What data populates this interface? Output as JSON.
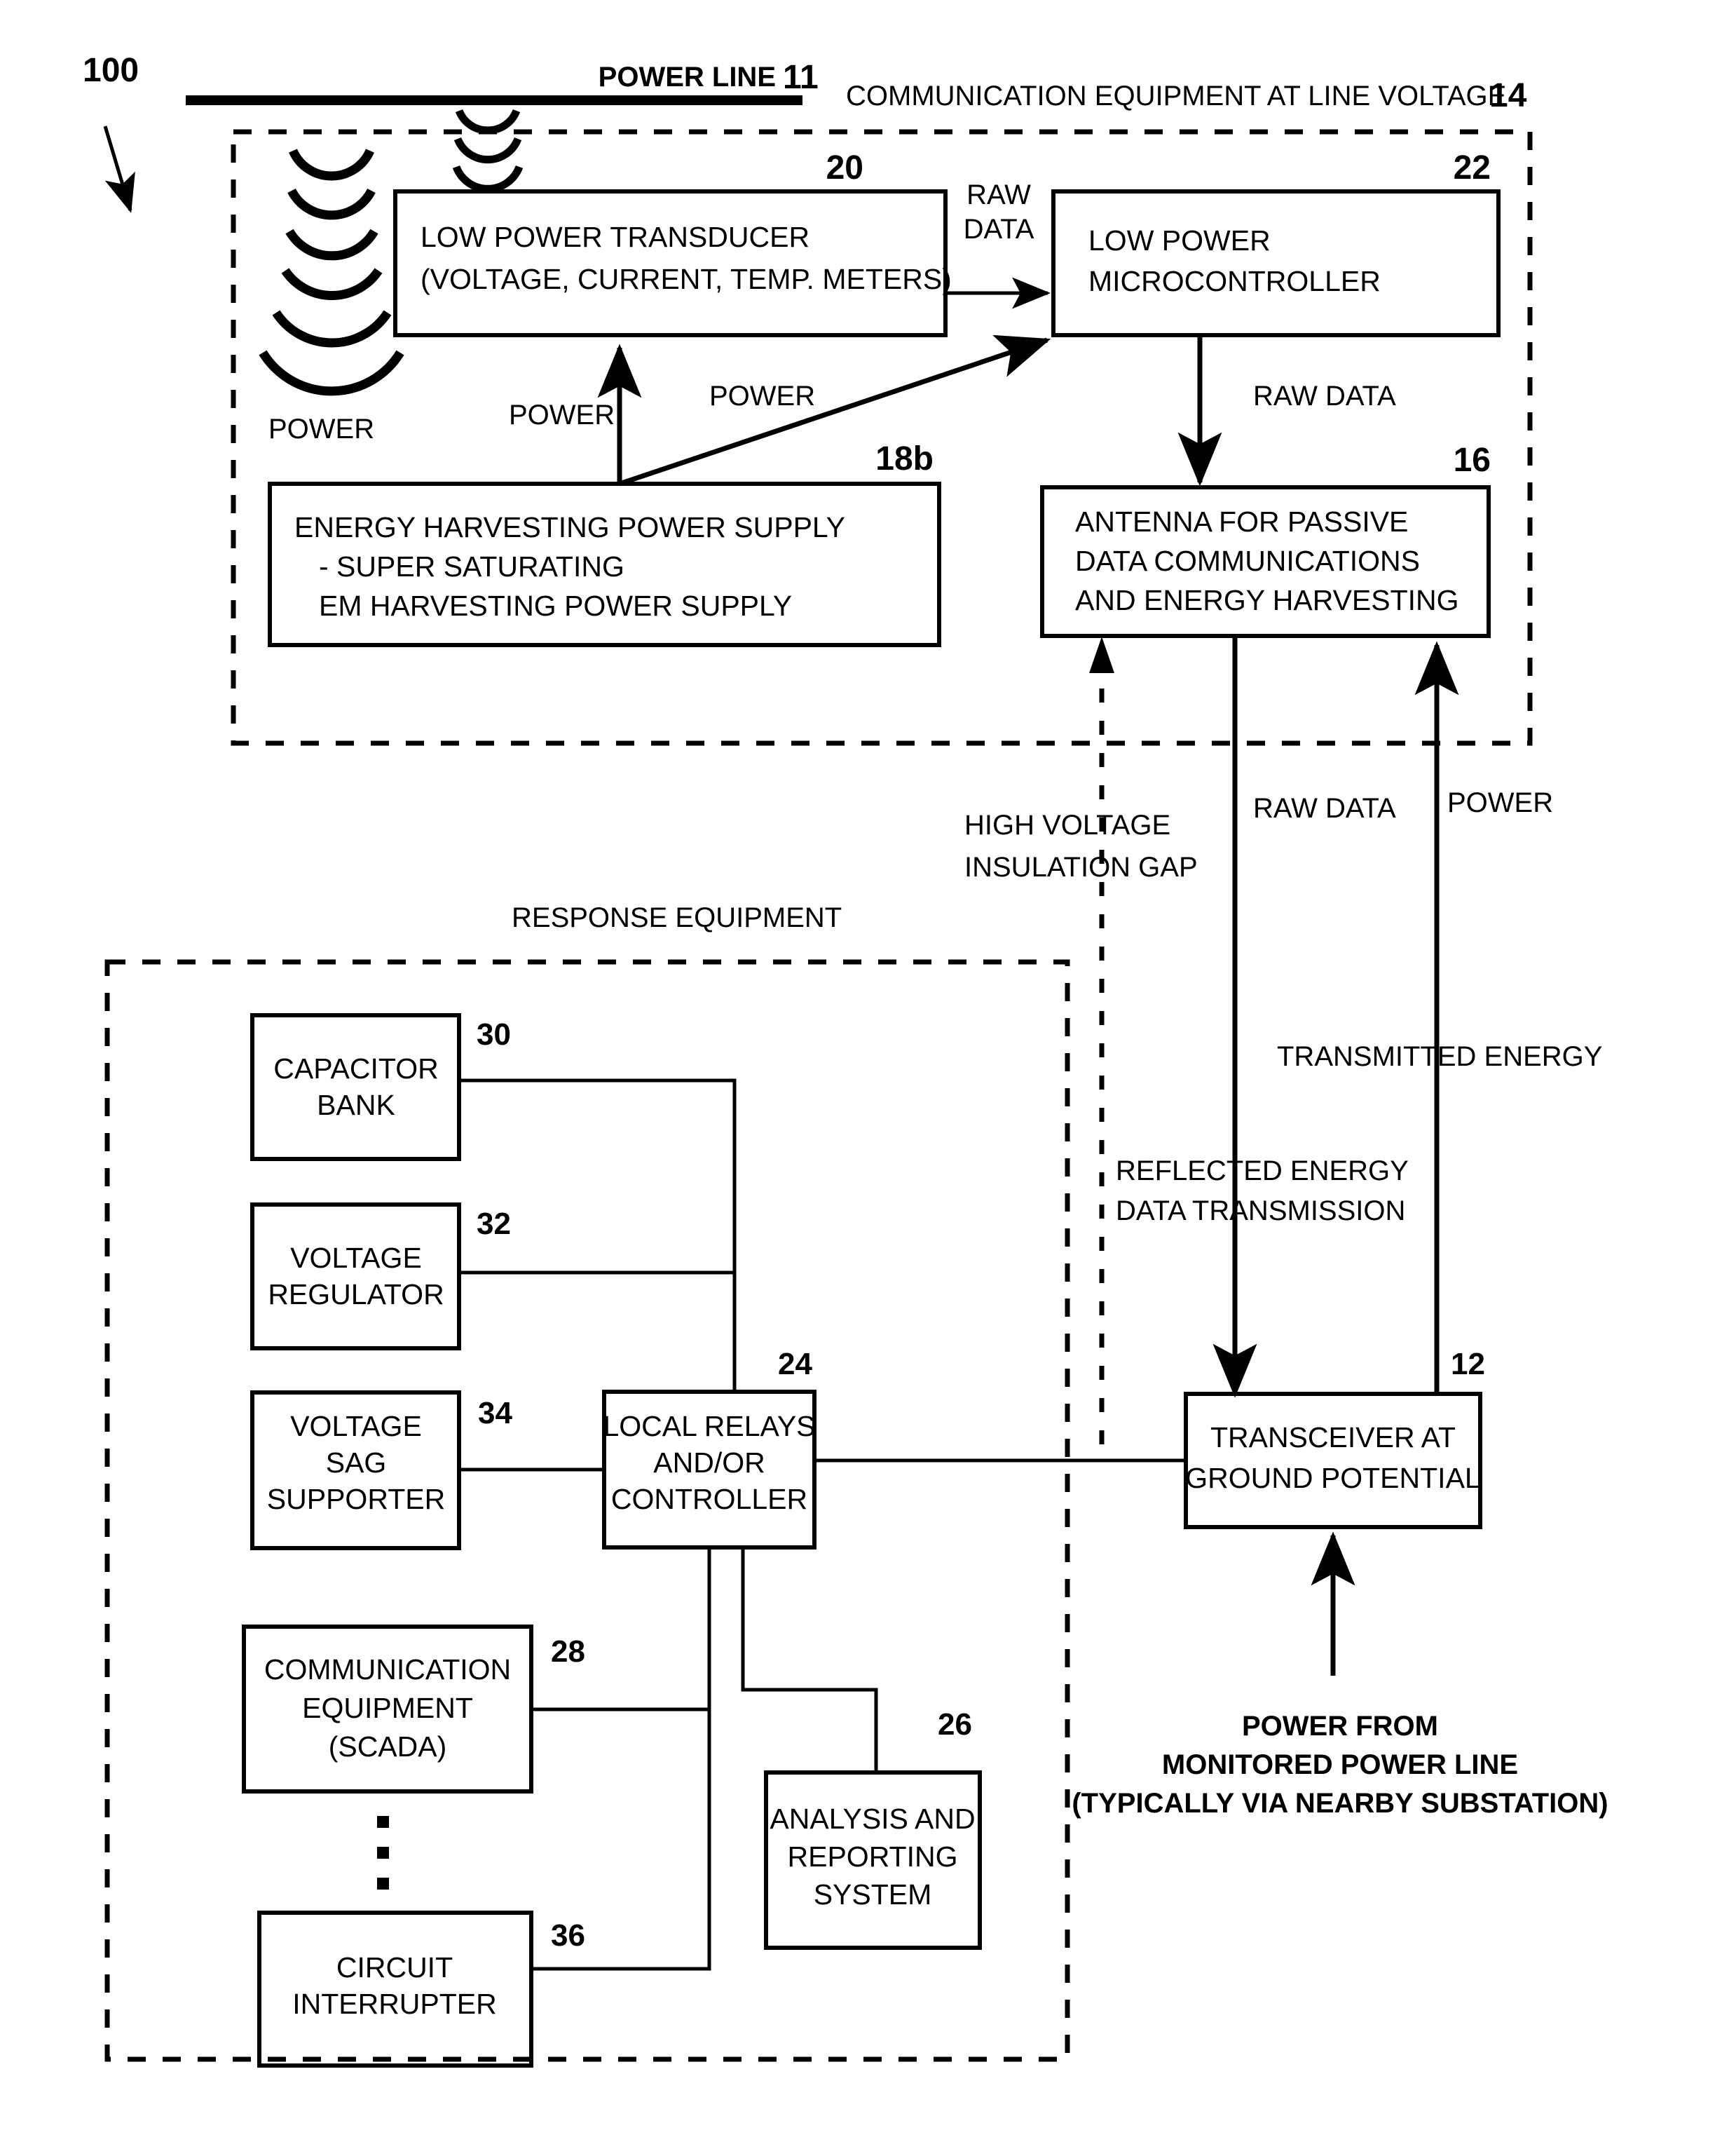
{
  "figure": {
    "reference_numeral": "100",
    "top_labels": {
      "power_line": "POWER LINE",
      "power_line_ref": "11",
      "comm_equipment": "COMMUNICATION EQUIPMENT AT LINE VOLTAGE",
      "comm_equipment_ref": "14"
    },
    "line_voltage_section": {
      "transducer": {
        "line1": "LOW POWER TRANSDUCER",
        "line2": "(VOLTAGE, CURRENT, TEMP. METERS)",
        "ref": "20"
      },
      "microcontroller": {
        "line1": "LOW POWER",
        "line2": "MICROCONTROLLER",
        "ref": "22"
      },
      "power_supply": {
        "line1": "ENERGY HARVESTING POWER SUPPLY",
        "line2": "- SUPER SATURATING",
        "line3": "EM HARVESTING POWER SUPPLY",
        "ref": "18b"
      },
      "antenna": {
        "line1": "ANTENNA FOR PASSIVE",
        "line2": "DATA COMMUNICATIONS",
        "line3": "AND ENERGY HARVESTING",
        "ref": "16"
      },
      "arrow_labels": {
        "raw_data_1": "RAW",
        "raw_data_2": "DATA",
        "raw_data_vertical": "RAW DATA",
        "power_left": "POWER",
        "power_mid": "POWER",
        "power_right": "POWER"
      }
    },
    "gap_labels": {
      "high_voltage_1": "HIGH VOLTAGE",
      "high_voltage_2": "INSULATION GAP",
      "raw_data": "RAW DATA",
      "power": "POWER",
      "transmitted_energy": "TRANSMITTED ENERGY",
      "reflected_1": "REFLECTED ENERGY",
      "reflected_2": "DATA TRANSMISSION"
    },
    "response_section": {
      "heading": "RESPONSE EQUIPMENT",
      "boxes": [
        {
          "key": "capacitor_bank",
          "lines": [
            "CAPACITOR",
            "BANK"
          ],
          "ref": "30"
        },
        {
          "key": "voltage_regulator",
          "lines": [
            "VOLTAGE",
            "REGULATOR"
          ],
          "ref": "32"
        },
        {
          "key": "voltage_sag_supporter",
          "lines": [
            "VOLTAGE",
            "SAG",
            "SUPPORTER"
          ],
          "ref": "34"
        },
        {
          "key": "local_relays",
          "lines": [
            "LOCAL RELAYS",
            "AND/OR",
            "CONTROLLER"
          ],
          "ref": "24"
        },
        {
          "key": "comm_scada",
          "lines": [
            "COMMUNICATION",
            "EQUIPMENT",
            "(SCADA)"
          ],
          "ref": "28"
        },
        {
          "key": "circuit_interrupter",
          "lines": [
            "CIRCUIT",
            "INTERRUPTER"
          ],
          "ref": "36"
        },
        {
          "key": "analysis_reporting",
          "lines": [
            "ANALYSIS AND",
            "REPORTING",
            "SYSTEM"
          ],
          "ref": "26"
        }
      ]
    },
    "ground_section": {
      "transceiver": {
        "line1": "TRANSCEIVER AT",
        "line2": "GROUND POTENTIAL",
        "ref": "12"
      },
      "power_source": {
        "line1": "POWER FROM",
        "line2": "MONITORED POWER LINE",
        "line3": "(TYPICALLY VIA NEARBY SUBSTATION)"
      }
    },
    "colors": {
      "ink": "#000000",
      "paper": "#ffffff"
    }
  }
}
